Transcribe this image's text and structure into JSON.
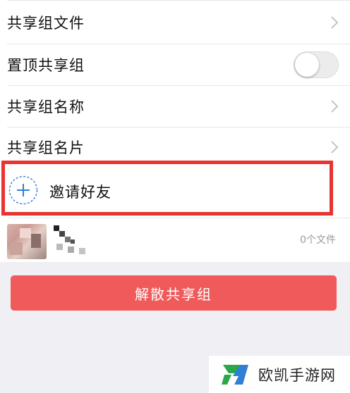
{
  "settings": {
    "shared_files": "共享组文件",
    "pin_group": "置顶共享组",
    "pin_enabled": false,
    "group_name": "共享组名称",
    "group_card": "共享组名片",
    "invite_friends": "邀请好友"
  },
  "members": {
    "file_count": "0个文件"
  },
  "actions": {
    "dissolve_label": "解散共享组"
  },
  "watermark": {
    "text": "欧凯手游网"
  },
  "colors": {
    "highlight_border": "#e8342f",
    "danger_button": "#f05a5a",
    "accent_blue": "#2f7fd6",
    "logo_green": "#2aa84a"
  },
  "icons": {
    "chevron": "chevron-right-icon",
    "invite": "plus-circle-icon",
    "logo": "okhand-logo-icon"
  }
}
